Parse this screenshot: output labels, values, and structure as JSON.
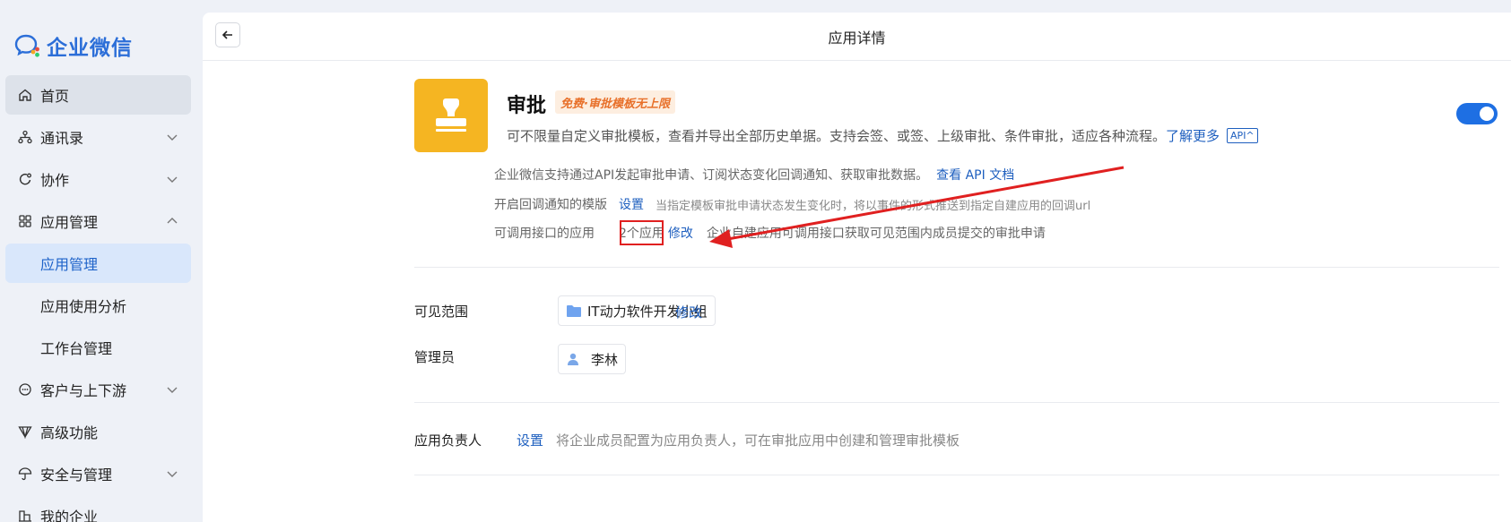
{
  "brand": {
    "name": "企业微信"
  },
  "sidebar": {
    "items": [
      {
        "label": "首页"
      },
      {
        "label": "通讯录"
      },
      {
        "label": "协作"
      },
      {
        "label": "应用管理"
      },
      {
        "label": "应用管理"
      },
      {
        "label": "应用使用分析"
      },
      {
        "label": "工作台管理"
      },
      {
        "label": "客户与上下游"
      },
      {
        "label": "高级功能"
      },
      {
        "label": "安全与管理"
      },
      {
        "label": "我的企业"
      }
    ]
  },
  "header": {
    "title": "应用详情"
  },
  "app": {
    "name": "审批",
    "badge": "免费·审批模板无上限",
    "description": "可不限量自定义审批模板，查看并导出全部历史单据。支持会签、或签、上级审批、条件审批，适应各种流程。",
    "learn_more": "了解更多",
    "api_tag": "API^",
    "enabled": true
  },
  "api_section": {
    "intro": "企业微信支持通过API发起审批申请、订阅状态变化回调通知、获取审批数据。",
    "doc_link": "查看 API 文档",
    "callback_label": "开启回调通知的模版",
    "callback_link": "设置",
    "callback_hint": "当指定模板审批申请状态发生变化时，将以事件的形式推送到指定自建应用的回调url",
    "apps_label": "可调用接口的应用",
    "apps_count": "2个应用",
    "apps_edit": "修改",
    "apps_hint": "企业自建应用可调用接口获取可见范围内成员提交的审批申请"
  },
  "visibility": {
    "label": "可见范围",
    "value": "IT动力软件开发小组",
    "edit": "修改"
  },
  "admin": {
    "label": "管理员",
    "value": "李林"
  },
  "owner": {
    "label": "应用负责人",
    "link": "设置",
    "hint": "将企业成员配置为应用负责人，可在审批应用中创建和管理审批模板"
  },
  "colors": {
    "accent": "#1e5fbf",
    "toggle": "#1e6fe3",
    "app_icon": "#f5b522",
    "annotation": "#e02020"
  }
}
